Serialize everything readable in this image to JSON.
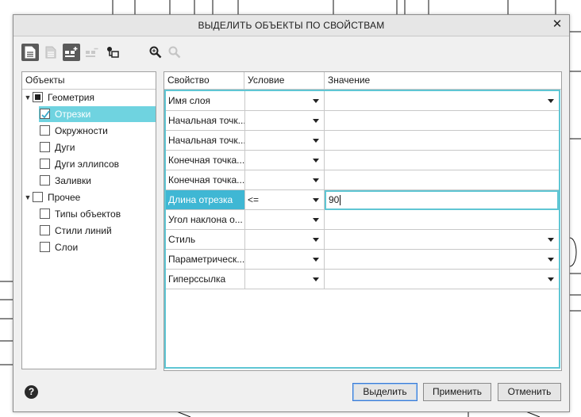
{
  "dialog": {
    "title": "ВЫДЕЛИТЬ ОБЪЕКТЫ ПО СВОЙСТВАМ",
    "close_glyph": "✕"
  },
  "toolbar": {
    "icons": [
      "document-icon",
      "document-disabled-icon",
      "add-filter-icon",
      "remove-filter-icon",
      "grid-select-icon",
      "zoom-icon",
      "zoom-disabled-icon"
    ]
  },
  "tree": {
    "header": "Объекты",
    "items": [
      {
        "label": "Геометрия",
        "state": "partial",
        "expanded": true,
        "level": 0
      },
      {
        "label": "Отрезки",
        "state": "checked",
        "level": 1,
        "selected": true
      },
      {
        "label": "Окружности",
        "state": "unchecked",
        "level": 1
      },
      {
        "label": "Дуги",
        "state": "unchecked",
        "level": 1
      },
      {
        "label": "Дуги эллипсов",
        "state": "unchecked",
        "level": 1
      },
      {
        "label": "Заливки",
        "state": "unchecked",
        "level": 1
      },
      {
        "label": "Прочее",
        "state": "unchecked",
        "expanded": true,
        "level": 0
      },
      {
        "label": "Типы объектов",
        "state": "unchecked",
        "level": 1
      },
      {
        "label": "Стили линий",
        "state": "unchecked",
        "level": 1
      },
      {
        "label": "Слои",
        "state": "unchecked",
        "level": 1
      }
    ]
  },
  "grid": {
    "columns": [
      "Свойство",
      "Условие",
      "Значение"
    ],
    "rows": [
      {
        "property": "Имя слоя",
        "condition": "",
        "value": "",
        "value_dropdown": true
      },
      {
        "property": "Начальная точк...",
        "condition": "",
        "value": "",
        "value_dropdown": false
      },
      {
        "property": "Начальная точк...",
        "condition": "",
        "value": "",
        "value_dropdown": false
      },
      {
        "property": "Конечная точка...",
        "condition": "",
        "value": "",
        "value_dropdown": false
      },
      {
        "property": "Конечная точка...",
        "condition": "",
        "value": "",
        "value_dropdown": false
      },
      {
        "property": "Длина отрезка",
        "condition": "<=",
        "value": "90",
        "value_dropdown": false,
        "highlighted": true
      },
      {
        "property": "Угол наклона о...",
        "condition": "",
        "value": "",
        "value_dropdown": false
      },
      {
        "property": "Стиль",
        "condition": "",
        "value": "",
        "value_dropdown": true
      },
      {
        "property": "Параметрическ...",
        "condition": "",
        "value": "",
        "value_dropdown": true
      },
      {
        "property": "Гиперссылка",
        "condition": "",
        "value": "",
        "value_dropdown": true
      }
    ]
  },
  "footer": {
    "help_glyph": "?",
    "select_label": "Выделить",
    "apply_label": "Применить",
    "cancel_label": "Отменить"
  },
  "colors": {
    "accent": "#5fc6d4",
    "selection": "#6fd3e0",
    "highlight": "#3fb7d4"
  }
}
